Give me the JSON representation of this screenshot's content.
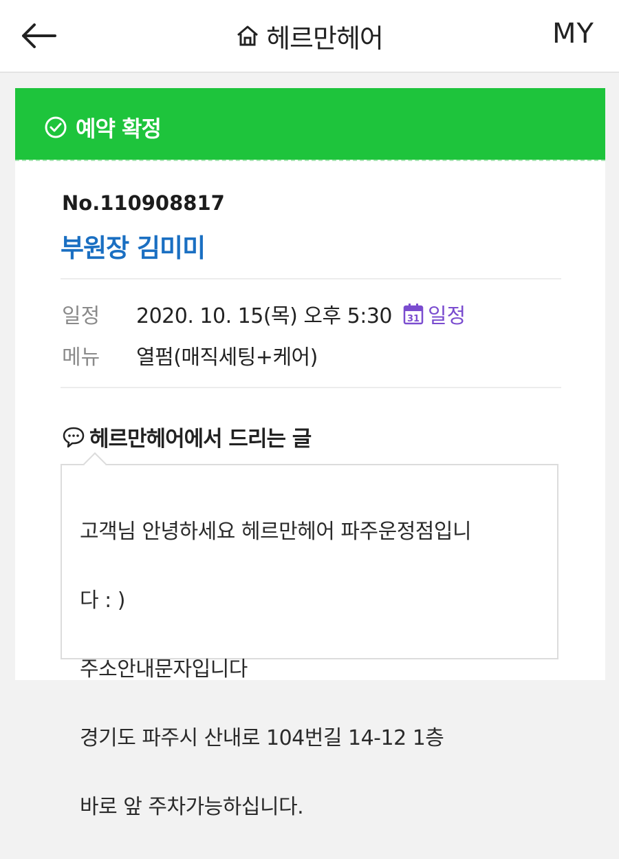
{
  "header": {
    "title": "헤르만헤어",
    "my_label": "MY",
    "icons": {
      "back": "back-arrow-icon",
      "home": "home-icon"
    }
  },
  "reservation": {
    "status": "예약 확정",
    "status_icon": "check-circle-icon",
    "status_color": "#1ec43c",
    "order_no": "No.110908817",
    "designer": "부원장 김미미",
    "designer_color": "#1a6fc2"
  },
  "details": {
    "schedule_label": "일정",
    "schedule_value": "2020. 10. 15(목) 오후 5:30",
    "calendar_icon_text": "31",
    "calendar_link": "일정",
    "calendar_link_color": "#7a4ccf",
    "menu_label": "메뉴",
    "menu_value": "열펌(매직세팅+케어)"
  },
  "message": {
    "heading": "헤르만헤어에서 드리는 글",
    "heading_icon": "speech-bubble-icon",
    "lines": [
      "고객님 안녕하세요 헤르만헤어 파주운정점입니",
      "다 : )",
      "주소안내문자입니다",
      "경기도 파주시 산내로 104번길 14-12 1층",
      "바로 앞 주차가능하십니다."
    ]
  }
}
